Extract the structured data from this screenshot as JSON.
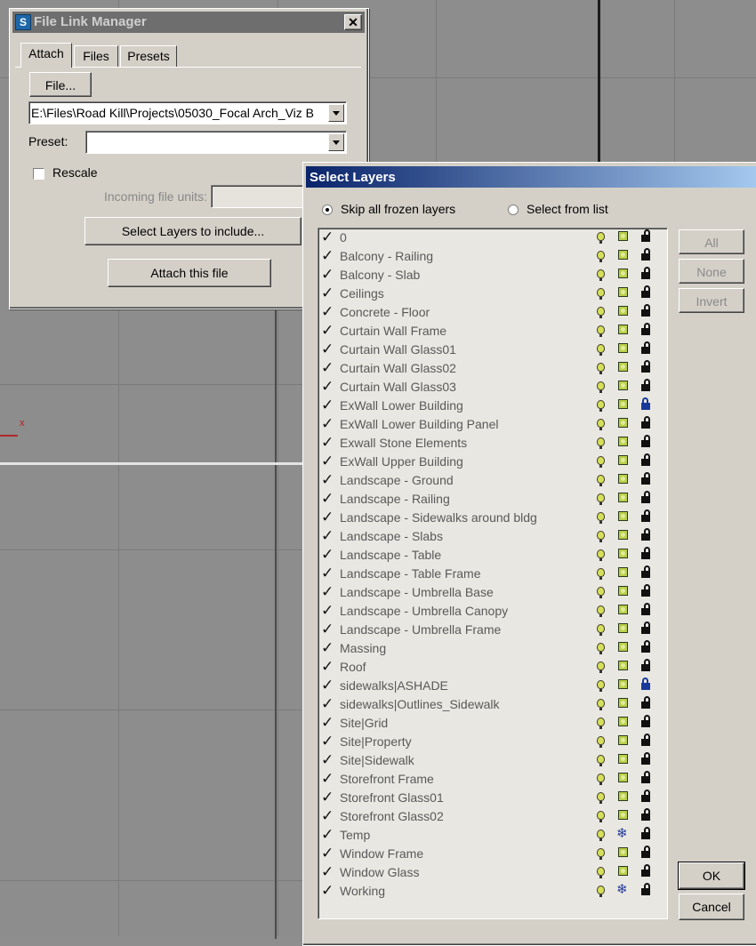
{
  "viewport": {
    "axis_label": "x"
  },
  "file_link_manager": {
    "title": "File Link Manager",
    "close_glyph": "✕",
    "tabs": [
      {
        "label": "Attach",
        "active": true
      },
      {
        "label": "Files"
      },
      {
        "label": "Presets"
      }
    ],
    "file_button": "File...",
    "file_path": "E:\\Files\\Road Kill\\Projects\\05030_Focal Arch_Viz B",
    "preset_label": "Preset:",
    "preset_value": "",
    "rescale_label": "Rescale",
    "incoming_units_label": "Incoming file units:",
    "select_layers_button": "Select Layers to include...",
    "attach_button": "Attach this file"
  },
  "select_layers": {
    "title": "Select Layers",
    "options": [
      {
        "label": "Skip all frozen layers",
        "selected": true
      },
      {
        "label": "Select from list",
        "selected": false
      }
    ],
    "buttons": {
      "all": "All",
      "none": "None",
      "invert": "Invert",
      "ok": "OK",
      "cancel": "Cancel"
    },
    "layers": [
      {
        "name": "0",
        "frozen": false,
        "locked": false
      },
      {
        "name": "Balcony - Railing",
        "frozen": false,
        "locked": false
      },
      {
        "name": "Balcony - Slab",
        "frozen": false,
        "locked": false
      },
      {
        "name": "Ceilings",
        "frozen": false,
        "locked": false
      },
      {
        "name": "Concrete - Floor",
        "frozen": false,
        "locked": false
      },
      {
        "name": "Curtain Wall Frame",
        "frozen": false,
        "locked": false
      },
      {
        "name": "Curtain Wall Glass01",
        "frozen": false,
        "locked": false
      },
      {
        "name": "Curtain Wall Glass02",
        "frozen": false,
        "locked": false
      },
      {
        "name": "Curtain Wall Glass03",
        "frozen": false,
        "locked": false
      },
      {
        "name": "ExWall Lower Building",
        "frozen": false,
        "locked": true
      },
      {
        "name": "ExWall Lower Building Panel",
        "frozen": false,
        "locked": false
      },
      {
        "name": "Exwall Stone Elements",
        "frozen": false,
        "locked": false
      },
      {
        "name": "ExWall Upper Building",
        "frozen": false,
        "locked": false
      },
      {
        "name": "Landscape - Ground",
        "frozen": false,
        "locked": false
      },
      {
        "name": "Landscape - Railing",
        "frozen": false,
        "locked": false
      },
      {
        "name": "Landscape - Sidewalks around bldg",
        "frozen": false,
        "locked": false
      },
      {
        "name": "Landscape - Slabs",
        "frozen": false,
        "locked": false
      },
      {
        "name": "Landscape - Table",
        "frozen": false,
        "locked": false
      },
      {
        "name": "Landscape - Table Frame",
        "frozen": false,
        "locked": false
      },
      {
        "name": "Landscape - Umbrella Base",
        "frozen": false,
        "locked": false
      },
      {
        "name": "Landscape - Umbrella Canopy",
        "frozen": false,
        "locked": false
      },
      {
        "name": "Landscape - Umbrella Frame",
        "frozen": false,
        "locked": false
      },
      {
        "name": "Massing",
        "frozen": false,
        "locked": false
      },
      {
        "name": "Roof",
        "frozen": false,
        "locked": false
      },
      {
        "name": "sidewalks|ASHADE",
        "frozen": false,
        "locked": true
      },
      {
        "name": "sidewalks|Outlines_Sidewalk",
        "frozen": false,
        "locked": false
      },
      {
        "name": "Site|Grid",
        "frozen": false,
        "locked": false
      },
      {
        "name": "Site|Property",
        "frozen": false,
        "locked": false
      },
      {
        "name": "Site|Sidewalk",
        "frozen": false,
        "locked": false
      },
      {
        "name": "Storefront Frame",
        "frozen": false,
        "locked": false
      },
      {
        "name": "Storefront Glass01",
        "frozen": false,
        "locked": false
      },
      {
        "name": "Storefront Glass02",
        "frozen": false,
        "locked": false
      },
      {
        "name": "Temp",
        "frozen": true,
        "locked": false
      },
      {
        "name": "Window Frame",
        "frozen": false,
        "locked": false
      },
      {
        "name": "Window Glass",
        "frozen": false,
        "locked": false
      },
      {
        "name": "Working",
        "frozen": true,
        "locked": false
      }
    ],
    "check_glyph": "✓",
    "snow_glyph": "❄"
  }
}
